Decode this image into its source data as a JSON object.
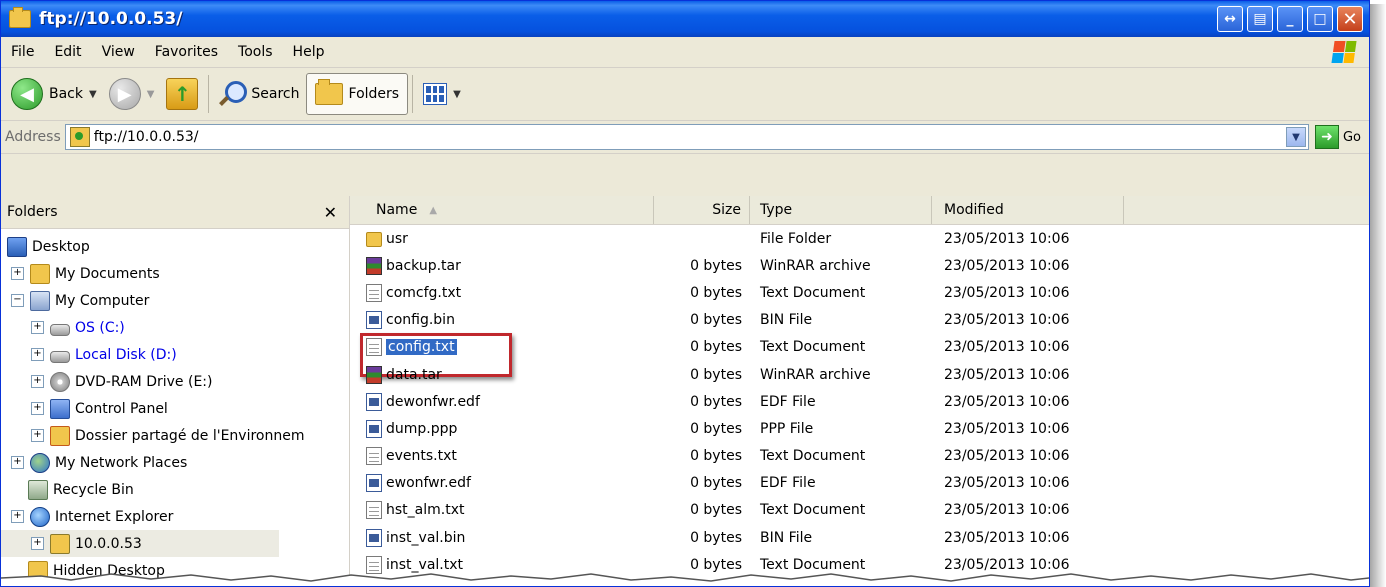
{
  "window": {
    "title": "ftp://10.0.0.53/"
  },
  "menu": [
    "File",
    "Edit",
    "View",
    "Favorites",
    "Tools",
    "Help"
  ],
  "toolbar": {
    "back": "Back",
    "search": "Search",
    "folders": "Folders"
  },
  "address": {
    "label": "Address",
    "value": "ftp://10.0.0.53/",
    "go": "Go"
  },
  "folders_pane": {
    "title": "Folders",
    "tree": [
      {
        "label": "Desktop",
        "icon": "desktop-icon"
      },
      {
        "label": "My Documents",
        "icon": "my-documents-icon"
      },
      {
        "label": "My Computer",
        "icon": "my-computer-icon"
      },
      {
        "label": "OS (C:)",
        "icon": "hard-drive-icon"
      },
      {
        "label": "Local Disk (D:)",
        "icon": "hard-drive-icon"
      },
      {
        "label": "DVD-RAM Drive (E:)",
        "icon": "dvd-drive-icon"
      },
      {
        "label": "Control Panel",
        "icon": "control-panel-icon"
      },
      {
        "label": "Dossier partagé de l'Environnem",
        "icon": "shared-folder-icon"
      },
      {
        "label": "My Network Places",
        "icon": "network-places-icon"
      },
      {
        "label": "Recycle Bin",
        "icon": "recycle-bin-icon"
      },
      {
        "label": "Internet Explorer",
        "icon": "internet-explorer-icon"
      },
      {
        "label": "10.0.0.53",
        "icon": "ftp-site-icon"
      },
      {
        "label": "Hidden Desktop",
        "icon": "folder-icon"
      }
    ]
  },
  "columns": {
    "name": "Name",
    "size": "Size",
    "type": "Type",
    "modified": "Modified"
  },
  "files": [
    {
      "name": "usr",
      "size": "",
      "type": "File Folder",
      "modified": "23/05/2013 10:06",
      "icon": "folder-icon"
    },
    {
      "name": "backup.tar",
      "size": "0 bytes",
      "type": "WinRAR archive",
      "modified": "23/05/2013 10:06",
      "icon": "winrar-icon"
    },
    {
      "name": "comcfg.txt",
      "size": "0 bytes",
      "type": "Text Document",
      "modified": "23/05/2013 10:06",
      "icon": "text-file-icon"
    },
    {
      "name": "config.bin",
      "size": "0 bytes",
      "type": "BIN File",
      "modified": "23/05/2013 10:06",
      "icon": "bin-file-icon"
    },
    {
      "name": "config.txt",
      "size": "0 bytes",
      "type": "Text Document",
      "modified": "23/05/2013 10:06",
      "icon": "text-file-icon"
    },
    {
      "name": "data.tar",
      "size": "0 bytes",
      "type": "WinRAR archive",
      "modified": "23/05/2013 10:06",
      "icon": "winrar-icon"
    },
    {
      "name": "dewonfwr.edf",
      "size": "0 bytes",
      "type": "EDF File",
      "modified": "23/05/2013 10:06",
      "icon": "bin-file-icon"
    },
    {
      "name": "dump.ppp",
      "size": "0 bytes",
      "type": "PPP File",
      "modified": "23/05/2013 10:06",
      "icon": "bin-file-icon"
    },
    {
      "name": "events.txt",
      "size": "0 bytes",
      "type": "Text Document",
      "modified": "23/05/2013 10:06",
      "icon": "text-file-icon"
    },
    {
      "name": "ewonfwr.edf",
      "size": "0 bytes",
      "type": "EDF File",
      "modified": "23/05/2013 10:06",
      "icon": "bin-file-icon"
    },
    {
      "name": "hst_alm.txt",
      "size": "0 bytes",
      "type": "Text Document",
      "modified": "23/05/2013 10:06",
      "icon": "text-file-icon"
    },
    {
      "name": "inst_val.bin",
      "size": "0 bytes",
      "type": "BIN File",
      "modified": "23/05/2013 10:06",
      "icon": "bin-file-icon"
    },
    {
      "name": "inst_val.txt",
      "size": "0 bytes",
      "type": "Text Document",
      "modified": "23/05/2013 10:06",
      "icon": "text-file-icon"
    }
  ],
  "selected_file": "config.txt",
  "colors": {
    "titlebar": "#0a5ee8",
    "selection": "#316ac5",
    "highlight_box": "#c0282d",
    "link_blue": "#0000e8"
  }
}
